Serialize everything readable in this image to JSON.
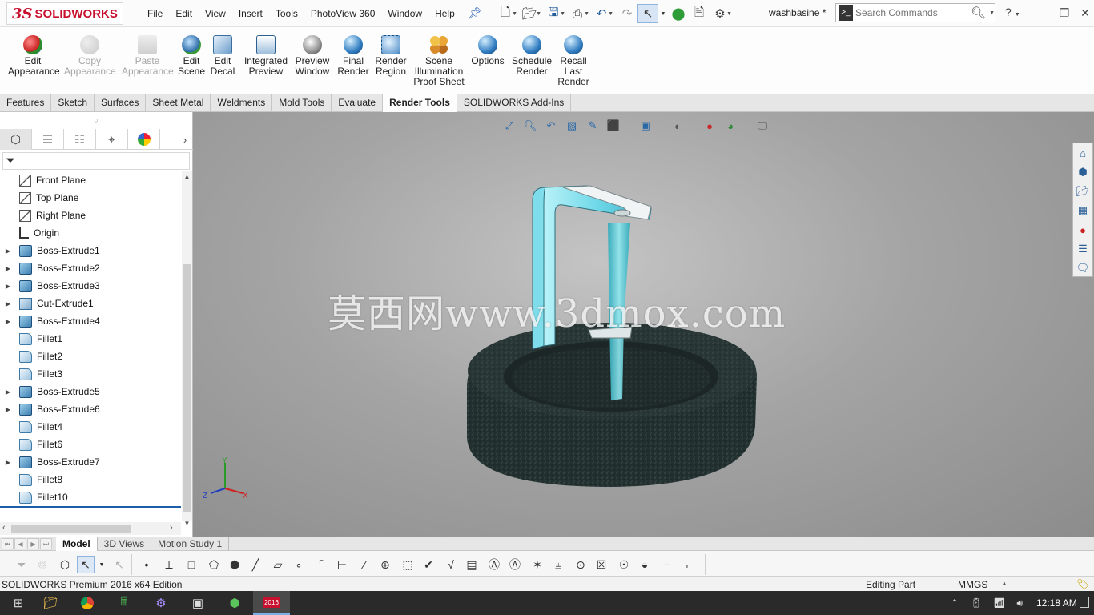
{
  "app": {
    "logo_ds": "3S",
    "logo_text": "SOLIDWORKS",
    "document_name": "washbasine *"
  },
  "menu": [
    "File",
    "Edit",
    "View",
    "Insert",
    "Tools",
    "PhotoView 360",
    "Window",
    "Help"
  ],
  "search": {
    "placeholder": "Search Commands",
    "cmd_glyph": ">_"
  },
  "ribbon": {
    "edit_appearance": [
      "Edit",
      "Appearance"
    ],
    "copy_appearance": [
      "Copy",
      "Appearance"
    ],
    "paste_appearance": [
      "Paste",
      "Appearance"
    ],
    "edit_scene": [
      "Edit",
      "Scene"
    ],
    "edit_decal": [
      "Edit",
      "Decal"
    ],
    "integrated_preview": [
      "Integrated",
      "Preview"
    ],
    "preview_window": [
      "Preview",
      "Window"
    ],
    "final_render": [
      "Final",
      "Render"
    ],
    "render_region": [
      "Render",
      "Region"
    ],
    "scene_illumination": [
      "Scene",
      "Illumination",
      "Proof Sheet"
    ],
    "options": [
      "Options"
    ],
    "schedule_render": [
      "Schedule",
      "Render"
    ],
    "recall_last_render": [
      "Recall",
      "Last",
      "Render"
    ]
  },
  "command_tabs": [
    "Features",
    "Sketch",
    "Surfaces",
    "Sheet Metal",
    "Weldments",
    "Mold Tools",
    "Evaluate",
    "Render Tools",
    "SOLIDWORKS Add-Ins"
  ],
  "active_command_tab": "Render Tools",
  "feature_tree": [
    {
      "label": "Front Plane",
      "type": "plane",
      "expandable": false
    },
    {
      "label": "Top Plane",
      "type": "plane",
      "expandable": false
    },
    {
      "label": "Right Plane",
      "type": "plane",
      "expandable": false
    },
    {
      "label": "Origin",
      "type": "origin",
      "expandable": false
    },
    {
      "label": "Boss-Extrude1",
      "type": "boss",
      "expandable": true
    },
    {
      "label": "Boss-Extrude2",
      "type": "boss",
      "expandable": true
    },
    {
      "label": "Boss-Extrude3",
      "type": "boss",
      "expandable": true
    },
    {
      "label": "Cut-Extrude1",
      "type": "cut",
      "expandable": true
    },
    {
      "label": "Boss-Extrude4",
      "type": "boss",
      "expandable": true
    },
    {
      "label": "Fillet1",
      "type": "fillet",
      "expandable": false
    },
    {
      "label": "Fillet2",
      "type": "fillet",
      "expandable": false
    },
    {
      "label": "Fillet3",
      "type": "fillet",
      "expandable": false
    },
    {
      "label": "Boss-Extrude5",
      "type": "boss",
      "expandable": true
    },
    {
      "label": "Boss-Extrude6",
      "type": "boss",
      "expandable": true
    },
    {
      "label": "Fillet4",
      "type": "fillet",
      "expandable": false
    },
    {
      "label": "Fillet6",
      "type": "fillet",
      "expandable": false
    },
    {
      "label": "Boss-Extrude7",
      "type": "boss",
      "expandable": true
    },
    {
      "label": "Fillet8",
      "type": "fillet",
      "expandable": false
    },
    {
      "label": "Fillet10",
      "type": "fillet",
      "expandable": false
    }
  ],
  "viewport": {
    "watermark": "莫西网www.3dmox.com",
    "triad": {
      "x": "X",
      "y": "Y",
      "z": "Z"
    }
  },
  "bottom_tabs": [
    "Model",
    "3D Views",
    "Motion Study 1"
  ],
  "active_bottom_tab": "Model",
  "status": {
    "product": "SOLIDWORKS Premium 2016 x64 Edition",
    "mode": "Editing Part",
    "units": "MMGS"
  },
  "taskbar": {
    "clock": "12:18 AM",
    "sw_badge": "2016"
  },
  "colors": {
    "brand_red": "#c8102e",
    "accent_blue": "#1c5ea6",
    "faucet_cyan": "#7ee2ee",
    "basin_dark": "#23302f"
  }
}
